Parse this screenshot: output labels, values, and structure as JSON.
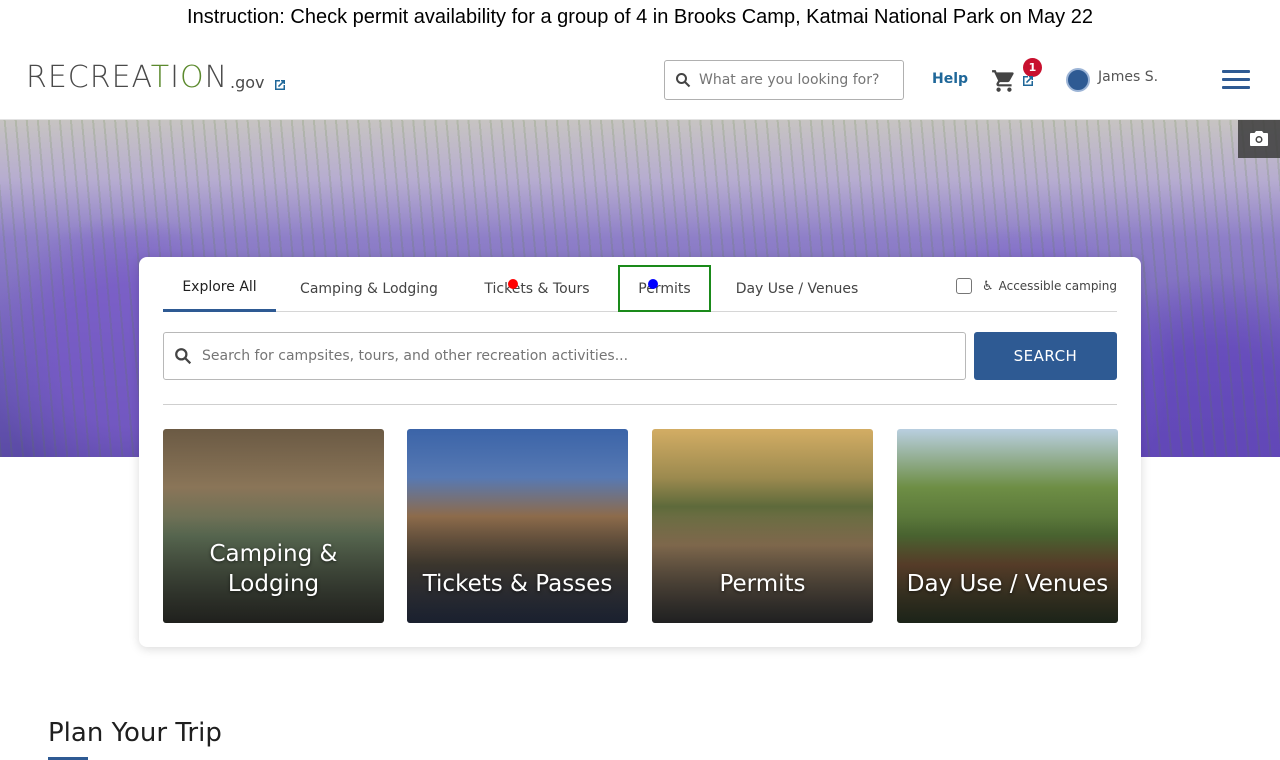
{
  "instruction": "Instruction: Check permit availability for a group of 4 in Brooks Camp, Katmai National Park on May 22",
  "header": {
    "logo_main_pre": "RECREA",
    "logo_main_tree": "T",
    "logo_main_post": "I",
    "logo_main_compass": "O",
    "logo_main_end": "N",
    "logo_gov": ".gov",
    "search_placeholder": "What are you looking for?",
    "help_label": "Help",
    "cart_count": "1",
    "user_name": "James S."
  },
  "tabs": [
    {
      "label": "Explore All"
    },
    {
      "label": "Camping & Lodging"
    },
    {
      "label": "Tickets & Tours"
    },
    {
      "label": "Permits"
    },
    {
      "label": "Day Use / Venues"
    }
  ],
  "accessible_label": "Accessible camping",
  "main_search": {
    "placeholder": "Search for campsites, tours, and other recreation activities...",
    "button_label": "SEARCH"
  },
  "cards": [
    {
      "label": "Camping & Lodging"
    },
    {
      "label": "Tickets & Passes"
    },
    {
      "label": "Permits"
    },
    {
      "label": "Day Use / Venues"
    }
  ],
  "plan_title": "Plan Your Trip",
  "colors": {
    "brand_blue": "#2e5a93",
    "link_blue": "#1f6799",
    "highlight_green": "#1a8a1a",
    "badge_red": "#c8102e",
    "marker_red": "#ff0000",
    "marker_blue": "#0000ff"
  }
}
